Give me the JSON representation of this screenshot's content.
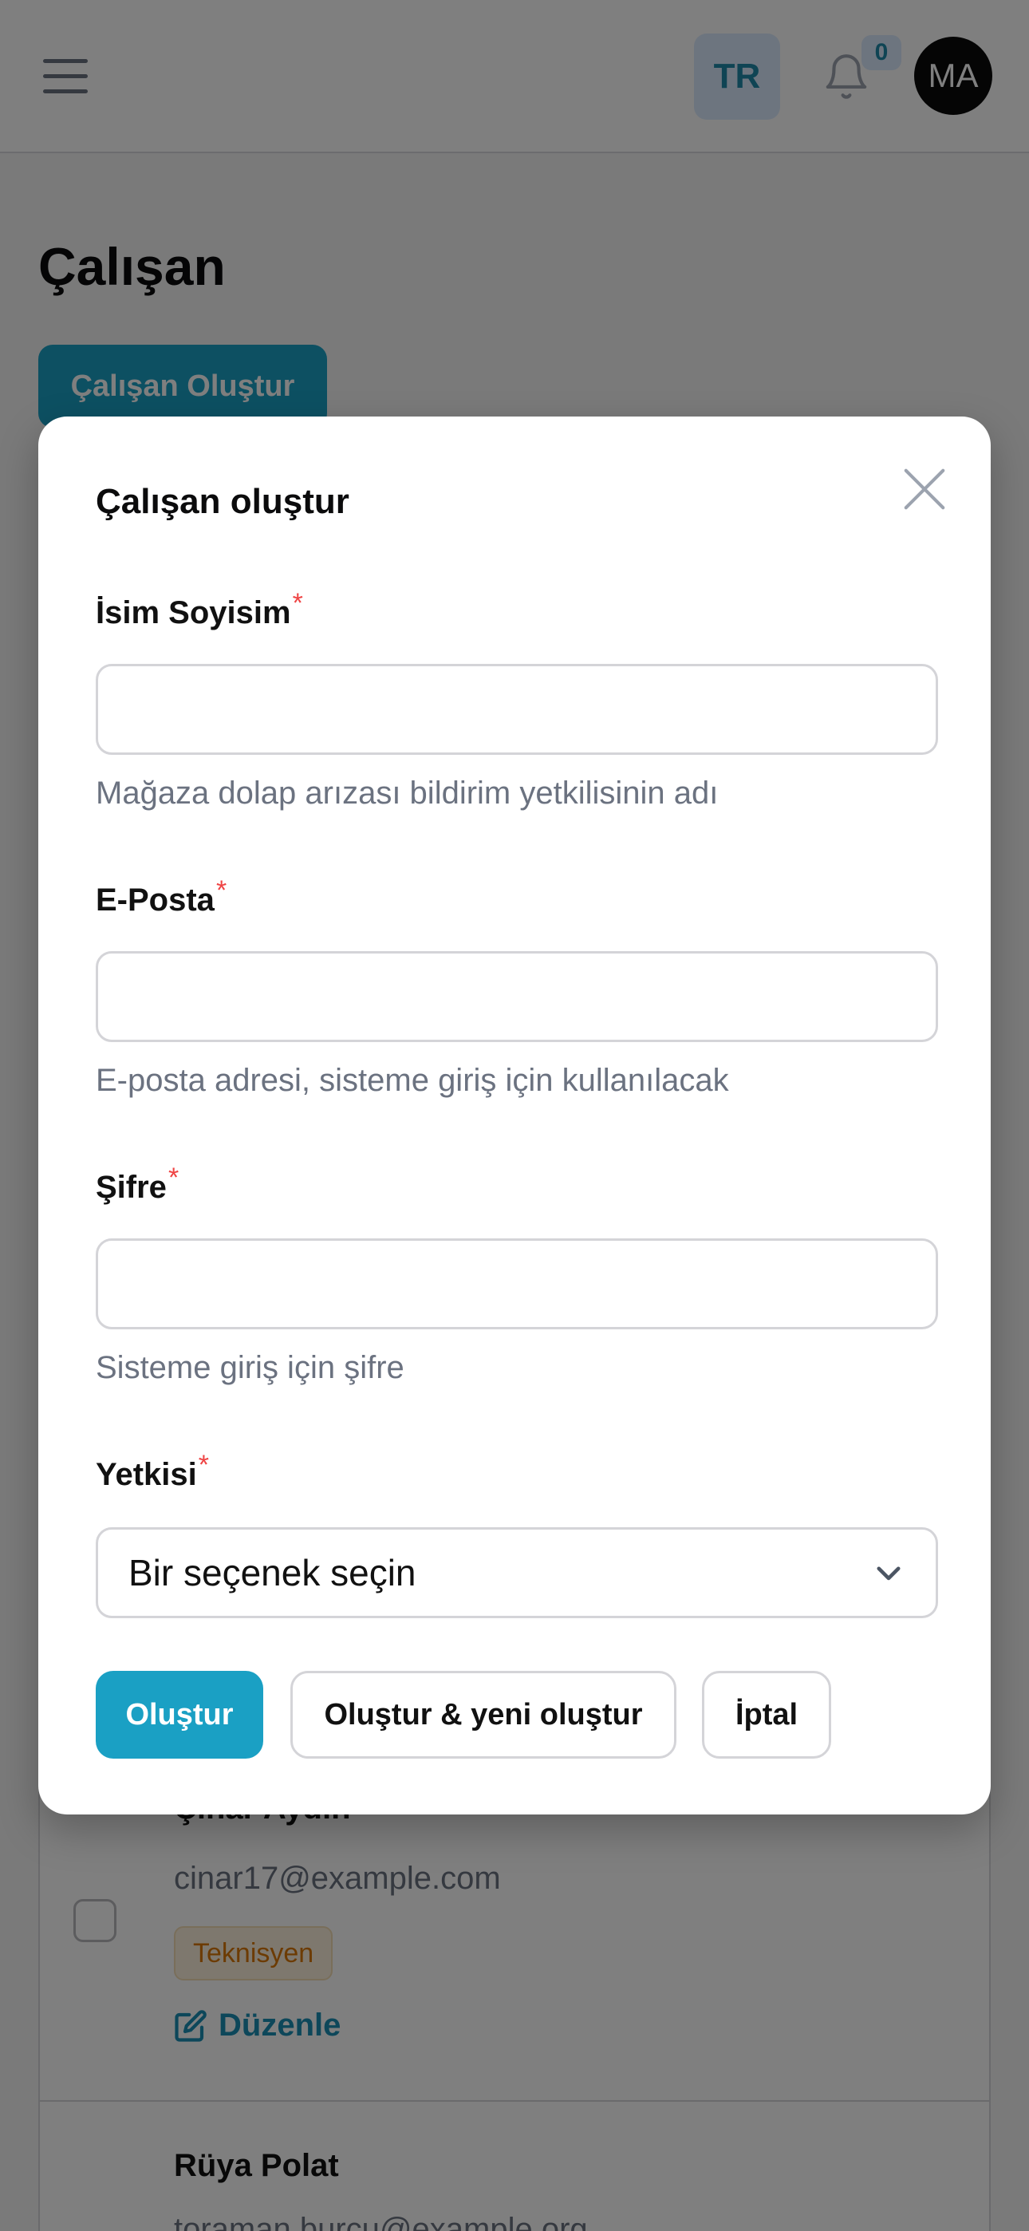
{
  "header": {
    "language_code": "TR",
    "notification_count": "0",
    "avatar_initials": "MA"
  },
  "page": {
    "title": "Çalışan",
    "create_button_label": "Çalışan Oluştur"
  },
  "table": {
    "rows": [
      {
        "name": "Çınar Aydın",
        "email": "cinar17@example.com",
        "role": "Teknisyen",
        "edit_label": "Düzenle"
      },
      {
        "name": "Rüya Polat",
        "email": "toraman.burcu@example.org"
      }
    ]
  },
  "modal": {
    "title": "Çalışan oluştur",
    "required_marker": "*",
    "fields": {
      "name": {
        "label": "İsim Soyisim",
        "value": "",
        "hint": "Mağaza dolap arızası bildirim yetkilisinin adı"
      },
      "email": {
        "label": "E-Posta",
        "value": "",
        "hint": "E-posta adresi, sisteme giriş için kullanılacak"
      },
      "password": {
        "label": "Şifre",
        "value": "",
        "hint": "Sisteme giriş için şifre"
      },
      "role": {
        "label": "Yetkisi",
        "selected": "Bir seçenek seçin"
      }
    },
    "buttons": {
      "create": "Oluştur",
      "create_and_new": "Oluştur & yeni oluştur",
      "cancel": "İptal"
    }
  },
  "colors": {
    "primary": "#1aa0c4",
    "required": "#ef4444",
    "badge_text": "#d97706"
  }
}
